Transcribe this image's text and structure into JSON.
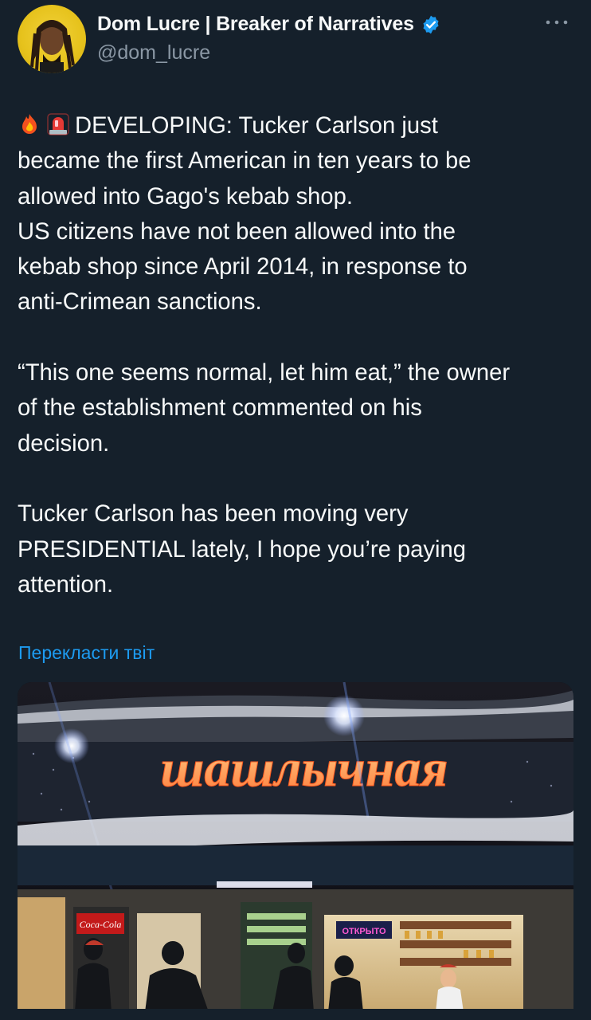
{
  "author": {
    "display_name": "Dom Lucre | Breaker of Narratives",
    "handle": "@dom_lucre",
    "verified": true,
    "verified_color": "#1d9bf0"
  },
  "tweet": {
    "emojis": [
      "fire-emoji",
      "rotating-light-emoji"
    ],
    "text": "DEVELOPING: Tucker Carlson just\nbecame the first American in ten years to be\nallowed into Gago's kebab shop.\nUS citizens have not been allowed into the\nkebab shop since April 2014, in response to\nanti-Crimean sanctions.\n\n“This one seems normal, let him eat,” the owner\nof the establishment commented on his\ndecision.\n\nTucker Carlson has been moving very\nPRESIDENTIAL lately, I hope you’re paying\nattention.",
    "translate_label": "Перекласти твіт"
  },
  "media": {
    "sign_text": "шашлычная",
    "small_sign_text": "ОТКРЫТО",
    "brand_sign_text": "Coca-Cola"
  },
  "colors": {
    "background": "#15202b",
    "text": "#f7f9f9",
    "secondary": "#8b98a5",
    "link": "#1d9bf0"
  }
}
